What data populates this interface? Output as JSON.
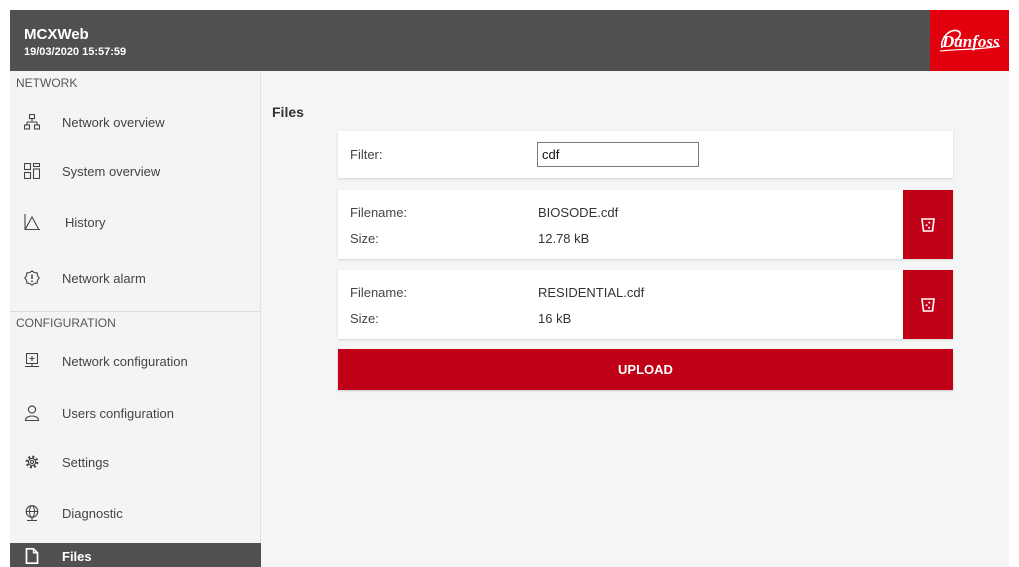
{
  "header": {
    "title": "MCXWeb",
    "datetime": "19/03/2020 15:57:59",
    "logo_text": "Danfoss",
    "logo_icon": "danfoss-logo",
    "brand_color": "#e2000f"
  },
  "sidebar": {
    "network_section": "NETWORK",
    "config_section": "CONFIGURATION",
    "network_items": [
      {
        "label": "Network overview",
        "icon": "network-icon"
      },
      {
        "label": "System overview",
        "icon": "grid-icon"
      },
      {
        "label": "History",
        "icon": "chart-icon"
      },
      {
        "label": "Network alarm",
        "icon": "alarm-icon"
      }
    ],
    "config_items": [
      {
        "label": "Network configuration",
        "icon": "network-config-icon"
      },
      {
        "label": "Users configuration",
        "icon": "user-icon"
      },
      {
        "label": "Settings",
        "icon": "gear-icon"
      },
      {
        "label": "Diagnostic",
        "icon": "globe-icon"
      },
      {
        "label": "Files",
        "icon": "file-icon",
        "active": true
      }
    ]
  },
  "main": {
    "title": "Files",
    "filter": {
      "label": "Filter:",
      "value": "cdf"
    },
    "files": [
      {
        "filename_label": "Filename:",
        "filename": "BIOSODE.cdf",
        "size_label": "Size:",
        "size": "12.78 kB"
      },
      {
        "filename_label": "Filename:",
        "filename": "RESIDENTIAL.cdf",
        "size_label": "Size:",
        "size": "16 kB"
      }
    ],
    "delete_icon": "trash-icon",
    "upload_label": "UPLOAD",
    "accent_color": "#c00017"
  }
}
